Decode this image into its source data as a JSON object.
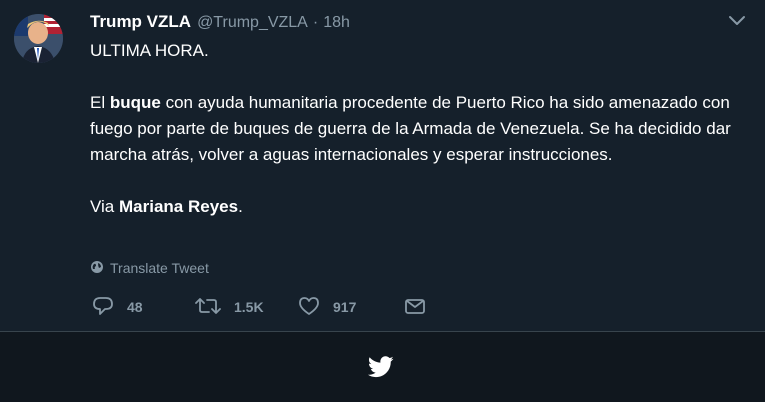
{
  "tweet": {
    "display_name": "Trump VZLA",
    "handle": "@Trump_VZLA",
    "separator": "·",
    "time": "18h",
    "body": {
      "line1": "ULTIMA HORA.",
      "p2_pre": "El ",
      "p2_bold": "buque",
      "p2_post": " con ayuda humanitaria procedente de Puerto Rico ha sido amenazado con fuego por parte de buques de guerra de la Armada de Venezuela. Se ha decidido dar marcha atrás, volver a aguas internacionales y esperar instrucciones.",
      "p3_pre": "Via ",
      "p3_bold": "Mariana Reyes",
      "p3_post": "."
    },
    "translate_label": "Translate Tweet",
    "actions": {
      "reply_count": "48",
      "retweet_count": "1.5K",
      "like_count": "917"
    }
  },
  "icons": [
    "avatar",
    "chevron-down-icon",
    "globe-icon",
    "reply-icon",
    "retweet-icon",
    "like-icon",
    "share-icon",
    "twitter-bird-icon"
  ],
  "colors": {
    "background": "#15202b",
    "footer": "#10171e",
    "muted": "#8899a6",
    "text": "#ffffff"
  }
}
